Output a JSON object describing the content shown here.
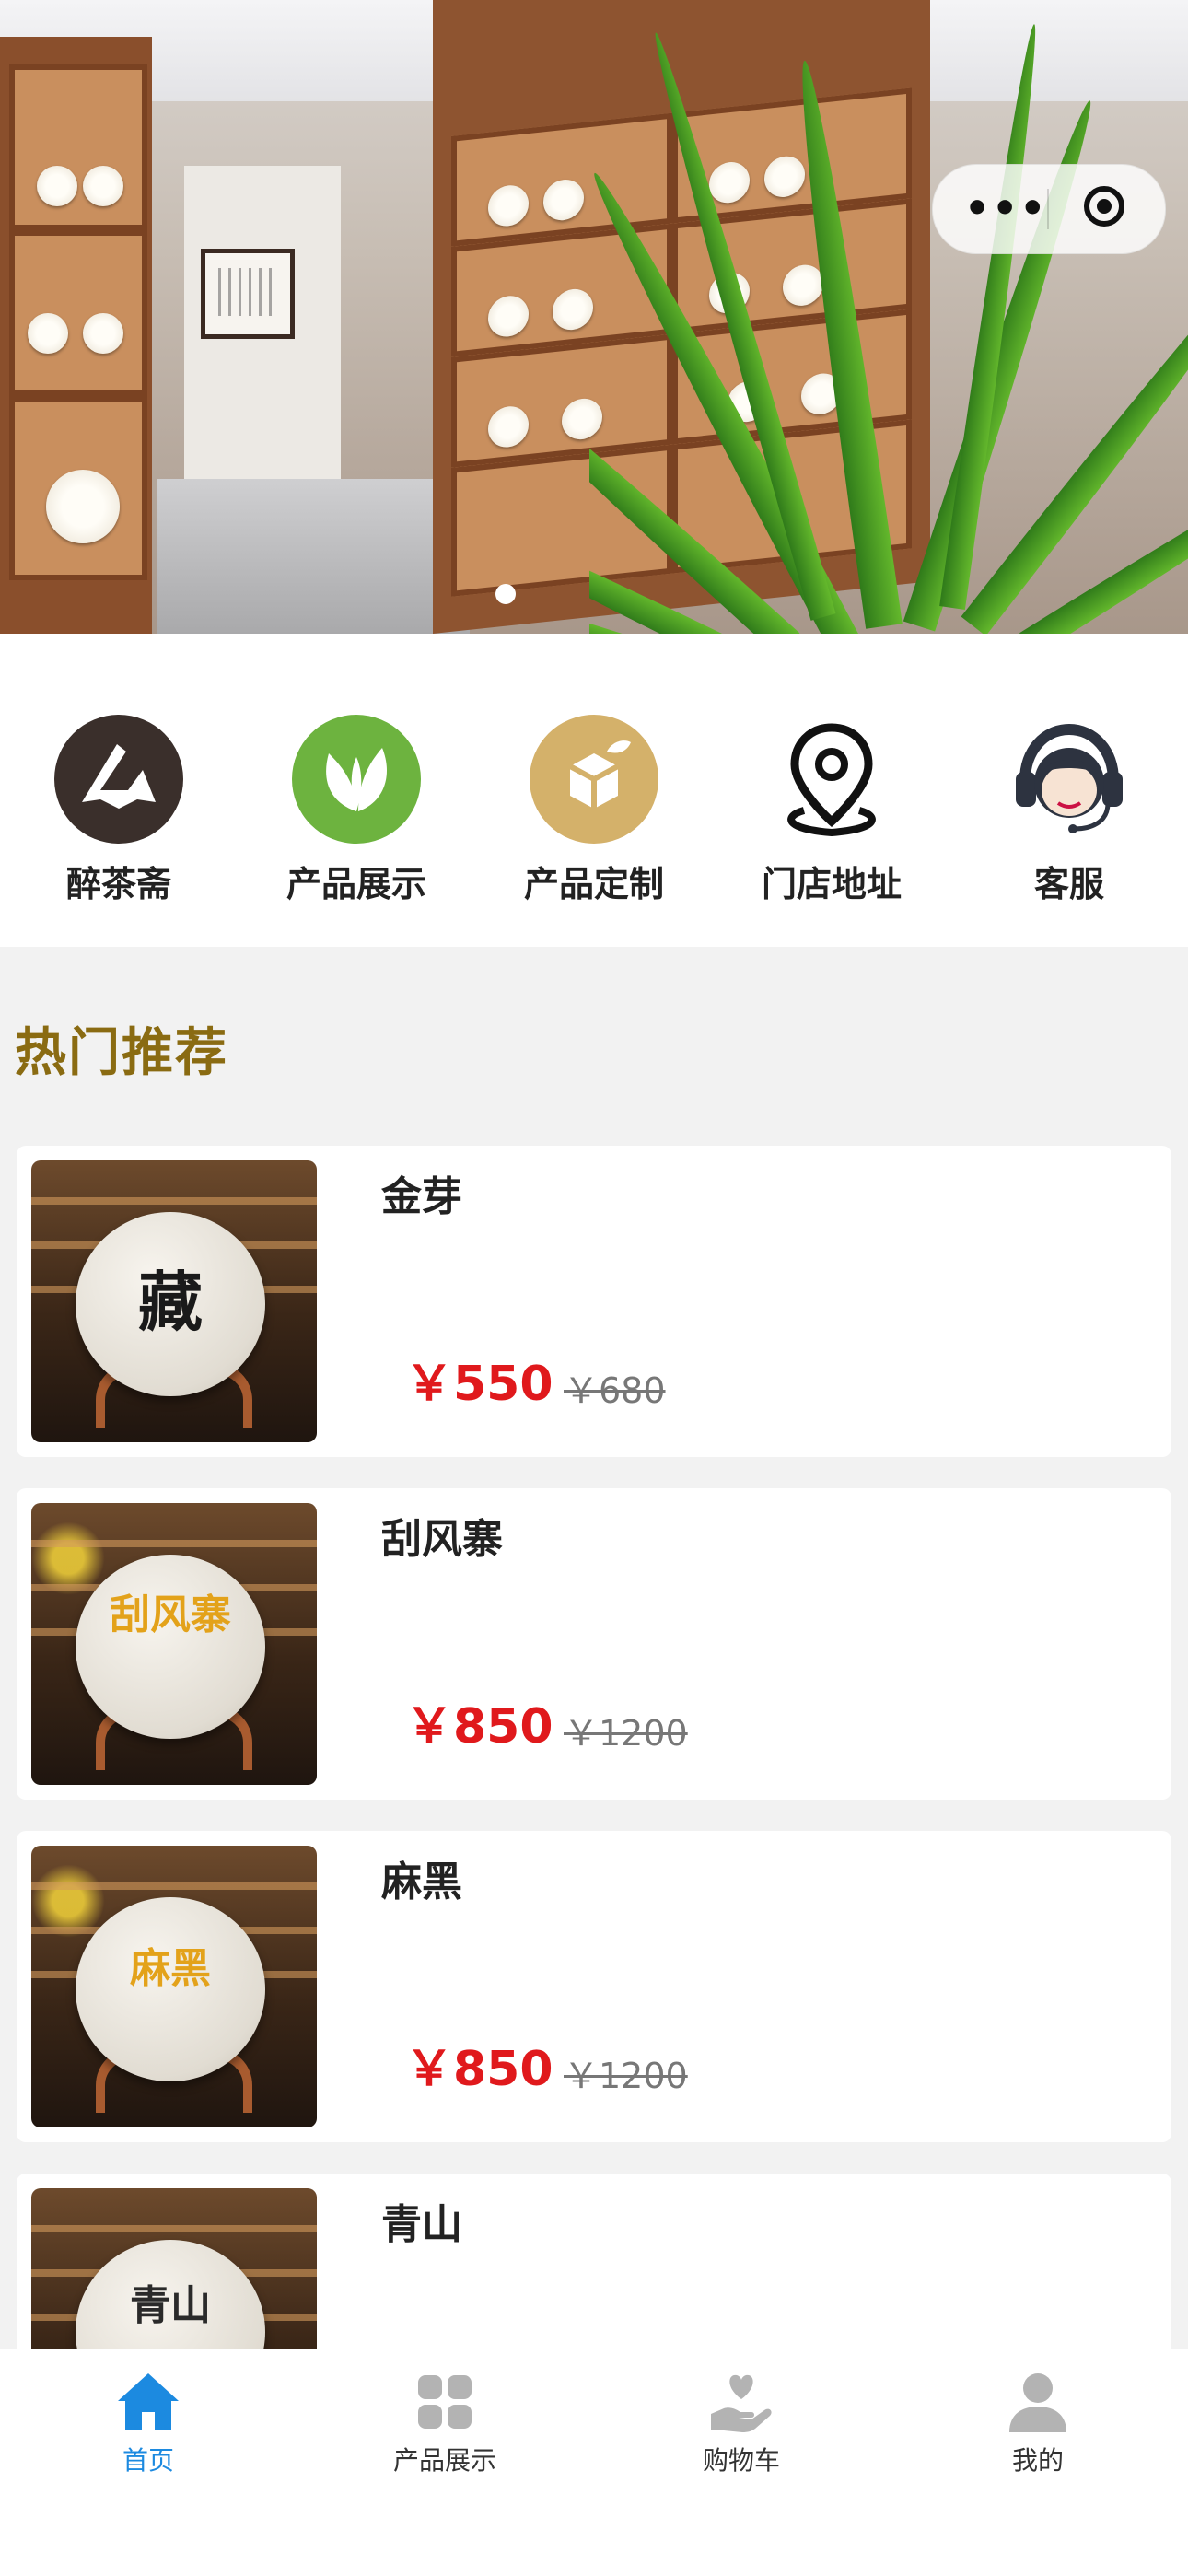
{
  "banner": {
    "slide_count": 1,
    "active_slide": 1
  },
  "capsule": {
    "more_label": "•••"
  },
  "nav": {
    "items": [
      {
        "label": "醉茶斋",
        "icon": "brand-logo-icon"
      },
      {
        "label": "产品展示",
        "icon": "tea-leaf-icon"
      },
      {
        "label": "产品定制",
        "icon": "cube-leaf-icon"
      },
      {
        "label": "门店地址",
        "icon": "location-pin-icon"
      },
      {
        "label": "客服",
        "icon": "customer-service-icon"
      }
    ]
  },
  "section": {
    "title": "热门推荐"
  },
  "products": [
    {
      "name": "金芽",
      "price": "￥550",
      "original_price": "￥680",
      "cake_text": "藏"
    },
    {
      "name": "刮风寨",
      "price": "￥850",
      "original_price": "￥1200",
      "cake_text": "刮风寨"
    },
    {
      "name": "麻黑",
      "price": "￥850",
      "original_price": "￥1200",
      "cake_text": "麻黑"
    },
    {
      "name": "青山",
      "price": "",
      "original_price": "",
      "cake_text": "青山"
    }
  ],
  "tabbar": {
    "items": [
      {
        "label": "首页",
        "icon": "home-icon",
        "active": true
      },
      {
        "label": "产品展示",
        "icon": "grid-icon",
        "active": false
      },
      {
        "label": "购物车",
        "icon": "cart-heart-hand-icon",
        "active": false
      },
      {
        "label": "我的",
        "icon": "user-icon",
        "active": false
      }
    ]
  },
  "colors": {
    "section_title": "#8a6b12",
    "price": "#e0191c",
    "tab_active": "#1c8ae0",
    "tab_inactive": "#b3b3b3"
  }
}
